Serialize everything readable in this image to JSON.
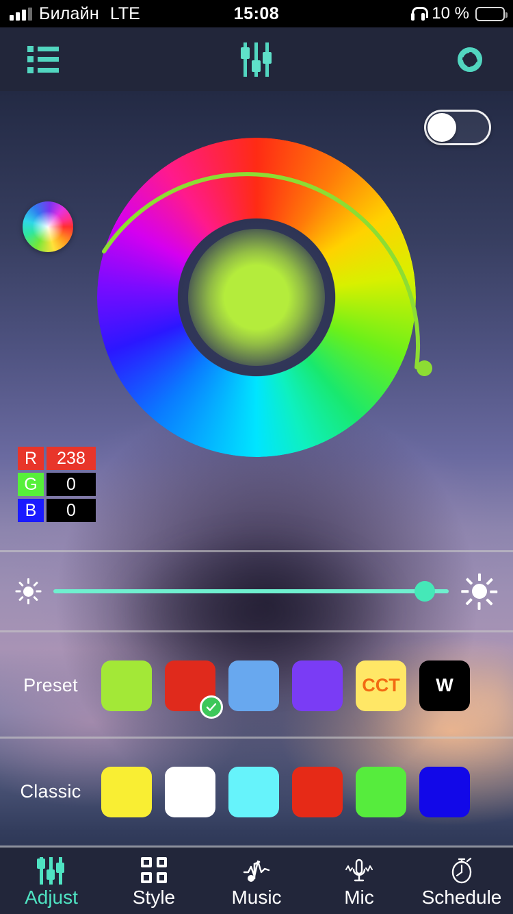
{
  "status_bar": {
    "carrier": "Билайн",
    "network": "LTE",
    "time": "15:08",
    "battery_percent": "10 %",
    "battery_level": 10,
    "headphones_icon": "headphones-icon",
    "signal_icon": "signal-bars-icon",
    "battery_icon": "battery-low-icon",
    "battery_color": "#f8cd42"
  },
  "top_nav": {
    "left_icon": "list-icon",
    "center_icon": "equalizer-icon",
    "right_icon": "gear-icon",
    "accent": "#52d6c0",
    "background": "#22263a"
  },
  "stage": {
    "color_wheel_icon": "color-wheel-icon",
    "power_toggle": {
      "label": "power-toggle",
      "state": "off"
    },
    "color_wheel": {
      "selected_color": "#b4ec3c",
      "arc_value_color": "#8ddd33"
    },
    "rgb": [
      {
        "channel": "R",
        "value": "238",
        "key_color": "#e8352a",
        "value_bg": "#e8352a"
      },
      {
        "channel": "G",
        "value": "0",
        "key_color": "#56f03a",
        "value_bg": "#000000"
      },
      {
        "channel": "B",
        "value": "0",
        "key_color": "#1a1aff",
        "value_bg": "#000000"
      }
    ]
  },
  "brightness": {
    "min_icon": "sun-small-icon",
    "max_icon": "sun-large-icon",
    "value_percent": 94,
    "track_color": "#6ff0cf",
    "knob_color": "#45e8b8"
  },
  "preset": {
    "label": "Preset",
    "swatches": [
      {
        "name": "preset-green",
        "color": "#a3e837",
        "text": "",
        "text_color": "",
        "selected": false
      },
      {
        "name": "preset-red",
        "color": "#e02a1c",
        "text": "",
        "text_color": "",
        "selected": true
      },
      {
        "name": "preset-blue",
        "color": "#68a8ef",
        "text": "",
        "text_color": "",
        "selected": false
      },
      {
        "name": "preset-purple",
        "color": "#7a3cf5",
        "text": "",
        "text_color": "",
        "selected": false
      },
      {
        "name": "preset-cct",
        "color": "#ffe766",
        "text": "CCT",
        "text_color": "#f26a12",
        "selected": false
      },
      {
        "name": "preset-white",
        "color": "#000000",
        "text": "W",
        "text_color": "#ffffff",
        "selected": false
      }
    ],
    "selected_badge": "check-icon"
  },
  "classic": {
    "label": "Classic",
    "swatches": [
      {
        "name": "classic-yellow",
        "color": "#f9ee33",
        "text": "",
        "text_color": "",
        "selected": false
      },
      {
        "name": "classic-white",
        "color": "#ffffff",
        "text": "",
        "text_color": "",
        "selected": false
      },
      {
        "name": "classic-cyan",
        "color": "#66f3fb",
        "text": "",
        "text_color": "",
        "selected": false
      },
      {
        "name": "classic-red",
        "color": "#e62a17",
        "text": "",
        "text_color": "",
        "selected": false
      },
      {
        "name": "classic-green",
        "color": "#56ec3d",
        "text": "",
        "text_color": "",
        "selected": false
      },
      {
        "name": "classic-blue",
        "color": "#1208e8",
        "text": "",
        "text_color": "",
        "selected": false
      }
    ]
  },
  "tab_bar": {
    "active_color": "#4fe3c2",
    "items": [
      {
        "label": "Adjust",
        "icon": "equalizer-icon",
        "active": true
      },
      {
        "label": "Style",
        "icon": "grid-icon",
        "active": false
      },
      {
        "label": "Music",
        "icon": "music-note-icon",
        "active": false
      },
      {
        "label": "Mic",
        "icon": "microphone-icon",
        "active": false
      },
      {
        "label": "Schedule",
        "icon": "stopwatch-icon",
        "active": false
      }
    ]
  }
}
